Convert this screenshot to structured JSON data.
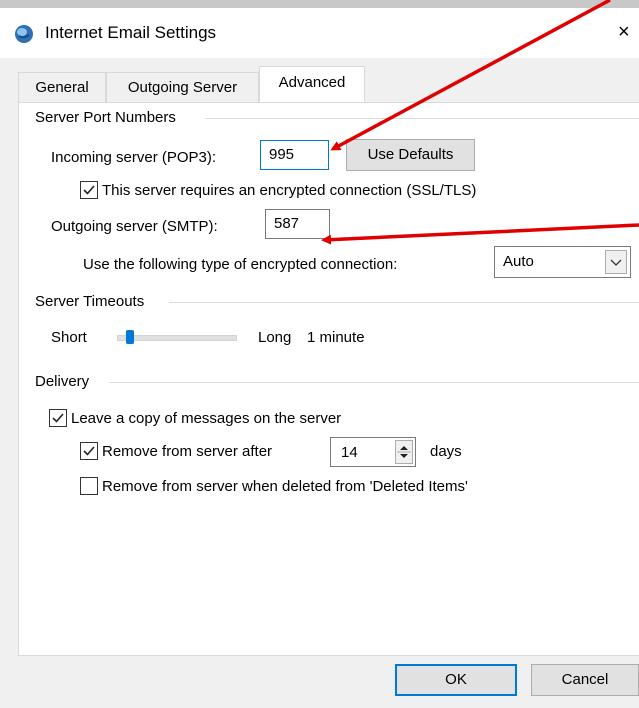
{
  "window": {
    "title": "Internet Email Settings",
    "close_glyph": "×"
  },
  "tabs": [
    {
      "label": "General",
      "active": false
    },
    {
      "label": "Outgoing Server",
      "active": false
    },
    {
      "label": "Advanced",
      "active": true
    }
  ],
  "port_section": {
    "heading": "Server Port Numbers",
    "incoming_label": "Incoming server (POP3):",
    "incoming_value": "995",
    "use_defaults_label": "Use Defaults",
    "ssl_checkbox_label": "This server requires an encrypted connection (SSL/TLS)",
    "ssl_checked": true,
    "outgoing_label": "Outgoing server (SMTP):",
    "outgoing_value": "587",
    "encryption_label": "Use the following type of encrypted connection:",
    "encryption_value": "Auto"
  },
  "timeouts": {
    "heading": "Server Timeouts",
    "short_label": "Short",
    "long_label": "Long",
    "value_text": "1 minute",
    "slider_fraction": 0.08
  },
  "delivery": {
    "heading": "Delivery",
    "leave_copy_label": "Leave a copy of messages on the server",
    "leave_copy_checked": true,
    "remove_after_label": "Remove from server after",
    "remove_after_checked": true,
    "days_value": "14",
    "days_label": "days",
    "remove_deleted_label": "Remove from server when deleted from 'Deleted Items'",
    "remove_deleted_checked": false
  },
  "footer": {
    "ok_label": "OK",
    "cancel_label": "Cancel"
  },
  "colors": {
    "accent": "#0078d7",
    "annotation_arrow": "#e00000",
    "dialog_bg": "#f0f0f0"
  },
  "icons": {
    "app": "outlook-globe-icon",
    "close": "close-icon",
    "check": "check-icon",
    "dropdown": "chevron-down-icon",
    "spinner": "spinner-icon"
  }
}
